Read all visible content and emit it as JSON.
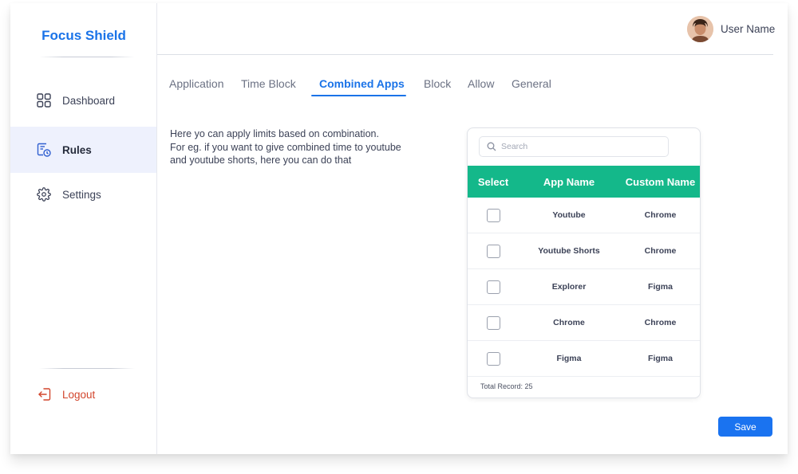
{
  "app": {
    "title": "Focus Shield"
  },
  "sidebar": {
    "items": [
      {
        "label": "Dashboard",
        "icon": "grid-icon"
      },
      {
        "label": "Rules",
        "icon": "rules-clock-icon",
        "active": true
      },
      {
        "label": "Settings",
        "icon": "gear-icon"
      }
    ],
    "logout_label": "Logout"
  },
  "header": {
    "user_name": "User Name"
  },
  "tabs": [
    {
      "label": "Application"
    },
    {
      "label": "Time Block"
    },
    {
      "label": "Combined Apps",
      "active": true
    },
    {
      "label": "Block"
    },
    {
      "label": "Allow"
    },
    {
      "label": "General"
    }
  ],
  "description": {
    "line1": "Here yo can apply limits based on combination.",
    "line2": "For eg. if you want to give combined time to youtube",
    "line3": "and youtube shorts, here you can do that"
  },
  "table": {
    "search_placeholder": "Search",
    "columns": [
      "Select",
      "App Name",
      "Custom Name"
    ],
    "rows": [
      {
        "app_name": "Youtube",
        "custom_name": "Chrome",
        "selected": false
      },
      {
        "app_name": "Youtube Shorts",
        "custom_name": "Chrome",
        "selected": false
      },
      {
        "app_name": "Explorer",
        "custom_name": "Figma",
        "selected": false
      },
      {
        "app_name": "Chrome",
        "custom_name": "Chrome",
        "selected": false
      },
      {
        "app_name": "Figma",
        "custom_name": "Figma",
        "selected": false
      }
    ],
    "footer": "Total Record: 25"
  },
  "actions": {
    "save_label": "Save"
  },
  "colors": {
    "brand": "#1a73e8",
    "table_header": "#14b88a",
    "active_nav_bg": "#eef1fd",
    "logout": "#d2452c",
    "save_button": "#1a73f0"
  }
}
